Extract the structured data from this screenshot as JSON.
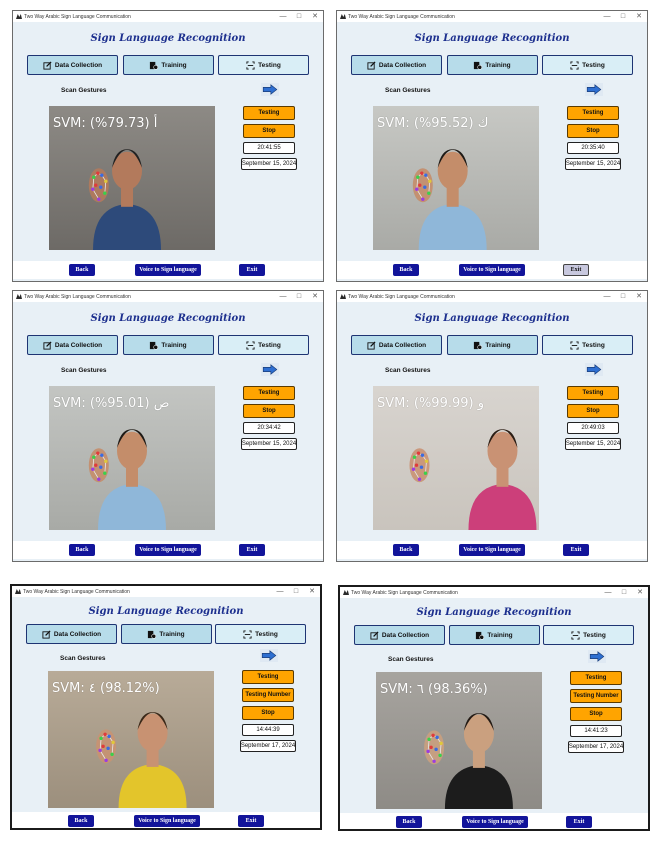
{
  "window_title": "Two Way Arabic Sign Language Communication",
  "window_controls": {
    "minimize": "—",
    "maximize": "□",
    "close": "✕"
  },
  "heading": "Sign Language Recognition",
  "tabs": [
    "Data Collection",
    "Training",
    "Testing"
  ],
  "scan_label": "Scan Gestures",
  "testing_label": "Testing",
  "testing_number_label": "Testing Number",
  "stop_label": "Stop",
  "back_label": "Back",
  "voice_label": "Voice to Sign language",
  "exit_label": "Exit",
  "colors": {
    "accent": "#1c2f8e",
    "tab_bg": "#b7dcea",
    "orange": "#ffa400",
    "nav_blue": "#12149a"
  },
  "icons": {
    "data_collection": "edit-icon",
    "training": "training-icon",
    "testing": "scan-icon",
    "next": "arrow-right-icon"
  },
  "screens": [
    {
      "svm": "SVM: (%79.73) أ",
      "time": "20:41:55",
      "date": "September 15, 2024"
    },
    {
      "svm": "SVM: (%95.52) ك",
      "time": "20:35:40",
      "date": "September 15, 2024"
    },
    {
      "svm": "SVM: (%95.01) ص",
      "time": "20:34:42",
      "date": "September 15, 2024"
    },
    {
      "svm": "SVM: (%99.99) و",
      "time": "20:49:03",
      "date": "September 15, 2024"
    },
    {
      "svm": "SVM: ٤ (98.12%)",
      "time": "14:44:39",
      "date": "September 17, 2024"
    },
    {
      "svm": "SVM: ٦ (98.36%)",
      "time": "14:41:23",
      "date": "September 17, 2024"
    }
  ]
}
